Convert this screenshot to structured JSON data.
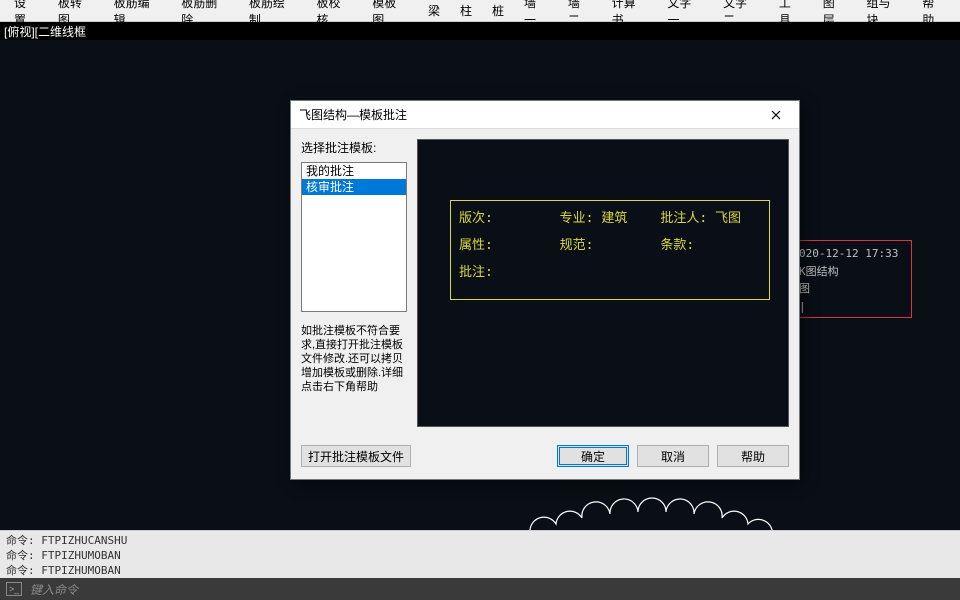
{
  "menubar": {
    "items": [
      "设置",
      "板转图",
      "板筋编辑",
      "板筋删除",
      "板筋绘制",
      "板校核",
      "模板图",
      "梁",
      "柱",
      "桩",
      "墙一",
      "墙二",
      "计算书",
      "文字一",
      "文字二",
      "工具",
      "图层",
      "组与块",
      "帮助"
    ]
  },
  "titlebar": {
    "text": "[俯视][二维线框"
  },
  "stamp": {
    "line1": "020-12-12 17:33",
    "line2": "K图结构",
    "line3": "图",
    "line4": "|"
  },
  "cmd_history": {
    "lines": [
      "命令: FTPIZHUCANSHU",
      "命令: FTPIZHUMOBAN",
      "命令: FTPIZHUMOBAN"
    ]
  },
  "cmd_input": {
    "icon": ">_",
    "placeholder": "键入命令"
  },
  "dialog": {
    "title": "飞图结构—模板批注",
    "list_label": "选择批注模板:",
    "list_items": [
      "我的批注",
      "核审批注"
    ],
    "selected_index": 1,
    "hint": "如批注模板不符合要求,直接打开批注模板文件修改.还可以拷贝增加模板或删除.详细点击右下角帮助",
    "preview": {
      "r1c1": "版次:",
      "r1c2": "专业: 建筑",
      "r1c3": "批注人: 飞图",
      "r2c1": "属性:",
      "r2c2": "规范:",
      "r2c3": "条款:",
      "r3c1": "批注:"
    },
    "buttons": {
      "open": "打开批注模板文件",
      "ok": "确定",
      "cancel": "取消",
      "help": "帮助"
    }
  }
}
